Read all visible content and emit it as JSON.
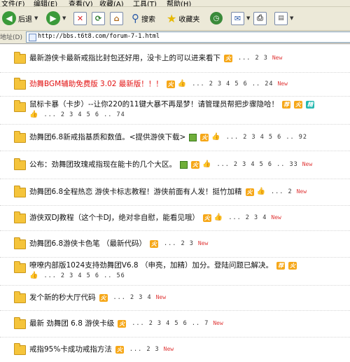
{
  "menu": [
    "文件(F)",
    "编辑(E)",
    "查看(V)",
    "收藏(A)",
    "工具(T)",
    "帮助(H)"
  ],
  "toolbar": {
    "back_label": "后退",
    "search_label": "搜索",
    "favorites_label": "收藏夹"
  },
  "address": {
    "label": "地址(D)",
    "url": "http://bbs.t6t8.com/forum-7-1.html"
  },
  "threads": [
    {
      "title": "最新游侠卡最新戒指比封包还好用，没卡上的可以进来看下",
      "red": false,
      "badges": [
        "火"
      ],
      "pages": "... 2 3",
      "new": "New"
    },
    {
      "title": "劲舞BGM辅助免费版 3.02 最新版！！！",
      "red": true,
      "badges": [
        "火",
        "thumb"
      ],
      "pages": "... 2 3 4 5 6 .. 24",
      "new": "New"
    },
    {
      "title": "鼠标卡暴（卡步）--让你220的11键大暴不再是梦！请管理员帮把步骤隐哈！",
      "red": false,
      "badges": [
        "荐",
        "火",
        "精"
      ],
      "line2_badges": [
        "thumb"
      ],
      "pages": "... 2 3 4 5 6 .. 74",
      "new": ""
    },
    {
      "title": "劲舞团6.8新戒指基质和数值。<提供游侠下载>",
      "red": false,
      "badges": [
        "img",
        "火",
        "thumb"
      ],
      "pages": "... 2 3 4 5 6 .. 92",
      "new": ""
    },
    {
      "title": "公布：劲舞团玫瑰戒指现在能卡的几个大区。",
      "red": false,
      "badges": [
        "img",
        "火",
        "thumb"
      ],
      "pages": "... 2 3 4 5 6 .. 33",
      "new": "New"
    },
    {
      "title": "劲舞团6.8全程热恋 游侠卡标志教程！游侠前面有人发！挺竹加精",
      "red": false,
      "badges": [
        "火",
        "thumb"
      ],
      "pages": "... 2",
      "new": "New"
    },
    {
      "title": "游侠双DJ教程（这个卡DJ，绝对非自慰，能看见哦）",
      "red": false,
      "badges": [
        "火",
        "thumb"
      ],
      "pages": "... 2 3 4",
      "new": "New"
    },
    {
      "title": "劲舞团6.8游侠卡色笔 （最新代码）",
      "red": false,
      "badges": [
        "火"
      ],
      "pages": "... 2 3",
      "new": "New"
    },
    {
      "title": "嘹嘹内部版1024支持劲舞团V6.8 （申亮，加精）加分。登陆问题已解决。",
      "red": false,
      "badges": [
        "荐",
        "火"
      ],
      "line2_badges": [
        "thumb"
      ],
      "pages": "... 2 3 4 5 6 .. 56",
      "new": ""
    },
    {
      "title": "发个新的秒大厅代码",
      "red": false,
      "badges": [
        "火"
      ],
      "pages": "... 2 3 4",
      "new": "New"
    },
    {
      "title": "最新 劲舞团 6.8 游侠卡级",
      "red": false,
      "badges": [
        "火"
      ],
      "pages": "... 2 3 4 5 6 .. 7",
      "new": "New"
    },
    {
      "title": "戒指95%卡成功戒指方法",
      "red": false,
      "badges": [
        "火"
      ],
      "pages": "... 2 3",
      "new": "New"
    }
  ],
  "colors": {
    "hot": "#f6a718",
    "red_title": "#e21010",
    "new": "#e03a3a",
    "folder": "#f5c43b"
  }
}
